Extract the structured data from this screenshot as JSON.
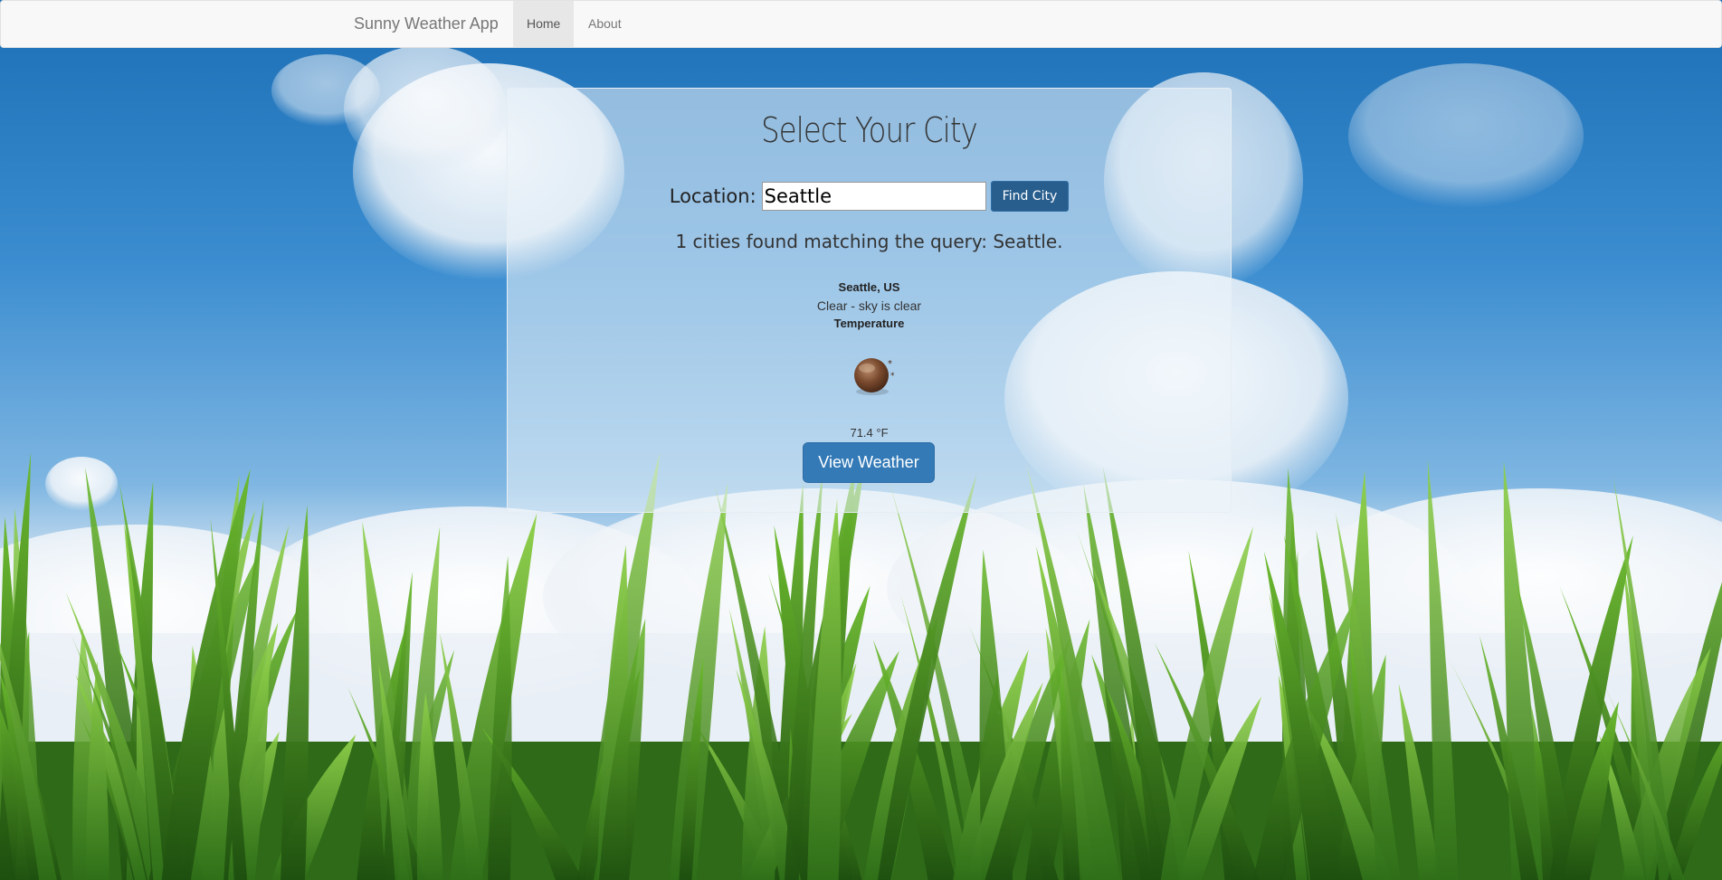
{
  "navbar": {
    "brand": "Sunny Weather App",
    "items": [
      {
        "label": "Home",
        "active": true
      },
      {
        "label": "About",
        "active": false
      }
    ]
  },
  "panel": {
    "title": "Select Your City",
    "location_label": "Location:",
    "location_value": "Seattle",
    "find_button": "Find City",
    "result_text": "1 cities found matching the query: Seattle.",
    "city": {
      "name": "Seattle, US",
      "description": "Clear - sky is clear",
      "temperature_label": "Temperature",
      "temperature_value": "71.4 °F",
      "icon": "clear-night-moon-icon"
    },
    "view_button": "View Weather"
  },
  "colors": {
    "primary_button": "#337ab7",
    "find_button": "#285e8e",
    "navbar_bg": "#f8f8f8",
    "active_nav_bg": "#e7e7e7"
  },
  "background": {
    "description_icon": "sky-clouds-cornfield-background"
  }
}
